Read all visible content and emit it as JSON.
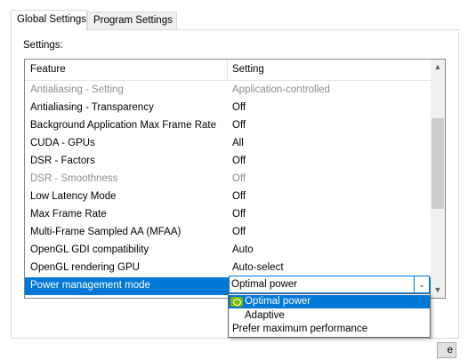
{
  "tabs": [
    {
      "label": "Global Settings",
      "active": true
    },
    {
      "label": "Program Settings",
      "active": false
    }
  ],
  "settings_label": "Settings:",
  "table": {
    "headers": [
      "Feature",
      "Setting"
    ],
    "rows": [
      {
        "feature": "Antialiasing - Setting",
        "setting": "Application-controlled",
        "disabled": true
      },
      {
        "feature": "Antialiasing - Transparency",
        "setting": "Off"
      },
      {
        "feature": "Background Application Max Frame Rate",
        "setting": "Off"
      },
      {
        "feature": "CUDA - GPUs",
        "setting": "All"
      },
      {
        "feature": "DSR - Factors",
        "setting": "Off"
      },
      {
        "feature": "DSR - Smoothness",
        "setting": "Off",
        "disabled": true
      },
      {
        "feature": "Low Latency Mode",
        "setting": "Off"
      },
      {
        "feature": "Max Frame Rate",
        "setting": "Off"
      },
      {
        "feature": "Multi-Frame Sampled AA (MFAA)",
        "setting": "Off"
      },
      {
        "feature": "OpenGL GDI compatibility",
        "setting": "Auto"
      },
      {
        "feature": "OpenGL rendering GPU",
        "setting": "Auto-select"
      },
      {
        "feature": "Power management mode",
        "setting": "Optimal power",
        "selected": true
      }
    ]
  },
  "combo": {
    "value": "Optimal power",
    "options": [
      "Optimal power",
      "Adaptive",
      "Prefer maximum performance"
    ],
    "highlighted_index": 0
  },
  "restore_button": {
    "label": "e"
  },
  "icons": {
    "scroll_up": "chevron-up-icon",
    "scroll_down": "chevron-down-icon",
    "combo": "chevron-down-icon",
    "nvidia": "nvidia-logo-icon"
  },
  "colors": {
    "selection": "#0078d7",
    "nvidia_green": "#76b900",
    "disabled_text": "#8d8d8d"
  }
}
